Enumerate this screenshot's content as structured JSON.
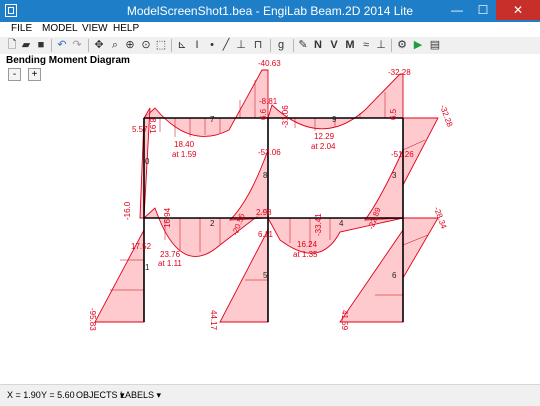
{
  "window": {
    "title": "ModelScreenShot1.bea - EngiLab Beam.2D 2014 Lite",
    "min": "—",
    "max": "☐",
    "close": "✕"
  },
  "menu": [
    "FILE",
    "MODEL",
    "VIEW",
    "HELP"
  ],
  "diagram": {
    "title": "Bending Moment Diagram",
    "zoom_out": "-",
    "zoom_in": "+"
  },
  "labels": [
    "-40.63",
    "-32.28",
    "-8.81",
    "-31.06",
    "-32.28",
    "5.57",
    "18.40",
    "at 1.59",
    "12.29",
    "at 2.04",
    "-53.06",
    "-51.26",
    "-28.34",
    "16.94",
    "-20.56",
    "-33.41",
    "-22.89",
    "17.52",
    "23.76",
    "at 1.11",
    "6.11",
    "16.24",
    "at 1.35",
    "-95.83",
    "44.17",
    "41.59",
    "-16.0",
    "8.91",
    "6.6",
    "6.5",
    "2.98"
  ],
  "node_labels": [
    "7",
    "8",
    "9",
    "1",
    "2",
    "3",
    "4",
    "5",
    "6",
    "0"
  ],
  "status": {
    "x": "X = 1.90",
    "y": "Y = 5.60",
    "objects": "OBJECTS ▾",
    "labels": "LABELS ▾"
  },
  "colors": {
    "accent": "#1e7fc8",
    "diagram_line": "#e0001b",
    "diagram_fill": "#ffb3b8"
  }
}
